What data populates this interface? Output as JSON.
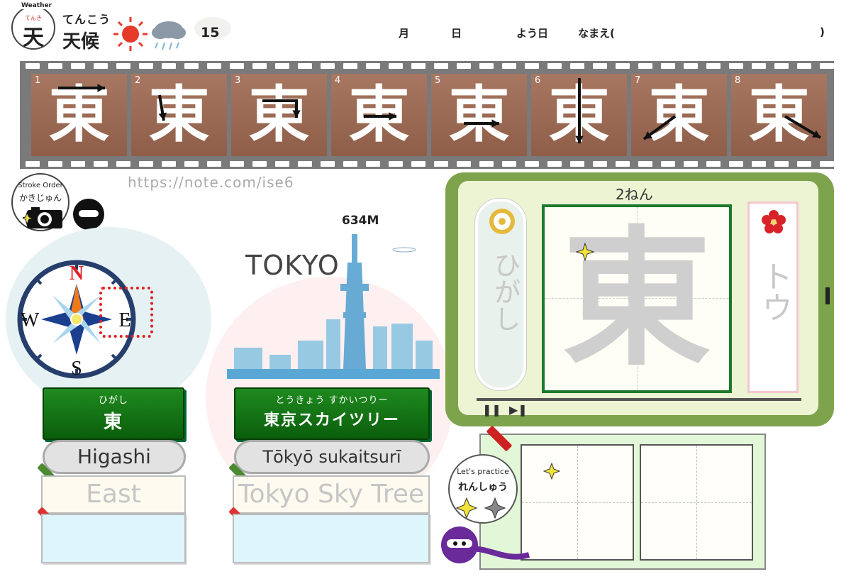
{
  "header": {
    "badge_tag": "Weather",
    "badge_furigana": "てんき",
    "badge_kanji": "天",
    "word_furigana": "てんこう",
    "word": "天候",
    "number": "15",
    "month_label": "月",
    "day_label": "日",
    "weekday_label": "よう日",
    "name_label": "なまえ(",
    "name_close": ")"
  },
  "film": {
    "character": "東",
    "frames": [
      "1",
      "2",
      "3",
      "4",
      "5",
      "6",
      "7",
      "8"
    ]
  },
  "url": "https://note.com/ise6",
  "stroke_order_badge": {
    "line1": "Stroke Order",
    "line2": "かきじゅん"
  },
  "compass": {
    "north": "N",
    "south": "S",
    "west": "W",
    "east": "E"
  },
  "word1": {
    "furigana": "ひがし",
    "kanji": "東",
    "romaji": "Higashi",
    "english": "East"
  },
  "word2": {
    "furigana": "とうきょう すかいつりー",
    "text": "東京スカイツリー",
    "romaji": "Tōkyō sukaitsurī",
    "english": "Tokyo Sky Tree"
  },
  "tokyo_illustration": {
    "label": "TOKYO",
    "height_label": "634M"
  },
  "tablet": {
    "grade": "2ねん",
    "kun_reading": "ひがし",
    "on_reading": "トウ",
    "character": "東"
  },
  "practice_badge": {
    "line1": "Let's practice",
    "line2": "れんしゅう"
  },
  "colors": {
    "film_frame": "#9c6a53",
    "sign_green": "#137013",
    "tablet_green": "#7ea34d",
    "compass_red": "#d22"
  }
}
